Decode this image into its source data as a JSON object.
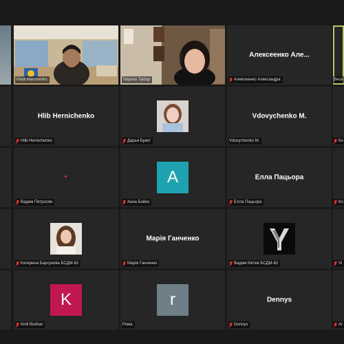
{
  "tiles": {
    "r1c0": {
      "label": ""
    },
    "r1c1": {
      "label": "Vitalii Marchenko"
    },
    "r1c2": {
      "label": "Tatyana Taidup"
    },
    "r1c3": {
      "big": "Алексеенко  Але...",
      "label": "Алексеенко Александра"
    },
    "r1c4": {
      "label": "Весе"
    },
    "r2c1": {
      "big": "Hlib Hernichenko",
      "label": "Hlib Hernichenko"
    },
    "r2c2": {
      "label": "Дарья Букет"
    },
    "r2c3": {
      "big": "Vdovychenko M.",
      "label": "Vdovychenko M."
    },
    "r2c4": {
      "label": "Ко"
    },
    "r3c1": {
      "label": "Вадим Петросян"
    },
    "r3c2": {
      "avatar": "A",
      "label": "Анна Бойко"
    },
    "r3c3": {
      "big": "Елла Пацьора",
      "label": "Елла Пацьора"
    },
    "r3c4": {
      "label": "Ко"
    },
    "r4c1": {
      "label": "Катерина Барсукова БСДМ-62"
    },
    "r4c2": {
      "big": "Марія Ганченко",
      "label": "Марія Ганченко"
    },
    "r4c3": {
      "label": "Вадим Кіктев БСДМ-62"
    },
    "r4c4": {
      "label": "Vi"
    },
    "r5c1": {
      "avatar": "K",
      "label": "Kirill Bodnar"
    },
    "r5c2": {
      "avatar": "r",
      "label": "Рома"
    },
    "r5c3": {
      "big": "Dennys",
      "label": "Dennys"
    },
    "r5c4": {
      "label": "Ar"
    }
  },
  "colors": {
    "avatar_a": "#1fa3b0",
    "avatar_k": "#c0184f",
    "avatar_r": "#6f7f88",
    "active_border": "#b9c96a"
  }
}
